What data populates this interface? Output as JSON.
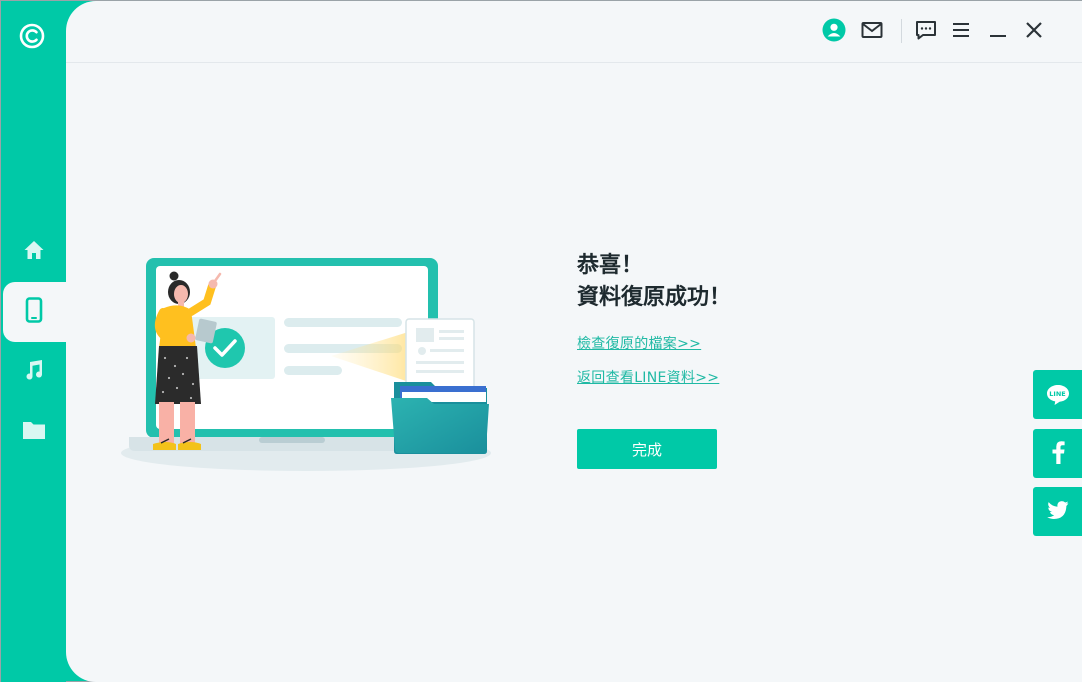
{
  "sidebar": {
    "logo_icon": "app-logo-c-icon",
    "items": [
      {
        "name": "home",
        "icon": "home-icon",
        "active": false
      },
      {
        "name": "device",
        "icon": "phone-icon",
        "active": true
      },
      {
        "name": "music",
        "icon": "music-note-icon",
        "active": false
      },
      {
        "name": "files",
        "icon": "folder-icon",
        "active": false
      }
    ]
  },
  "topbar": {
    "icons": [
      "account-icon",
      "mail-icon",
      "feedback-icon",
      "menu-icon",
      "minimize-icon",
      "close-icon"
    ]
  },
  "result": {
    "title_line1": "恭喜！",
    "title_line2": "資料復原成功！",
    "link_view_files": "檢查復原的檔案>>",
    "link_back_line": "返回查看LINE資料>>",
    "done_label": "完成"
  },
  "social": {
    "line_label": "LINE",
    "icons": [
      "line-icon",
      "facebook-icon",
      "twitter-icon"
    ]
  },
  "colors": {
    "accent": "#00c9a7",
    "background": "#f4f7f9",
    "link": "#1fb9a4",
    "text": "#1e2a2f"
  }
}
